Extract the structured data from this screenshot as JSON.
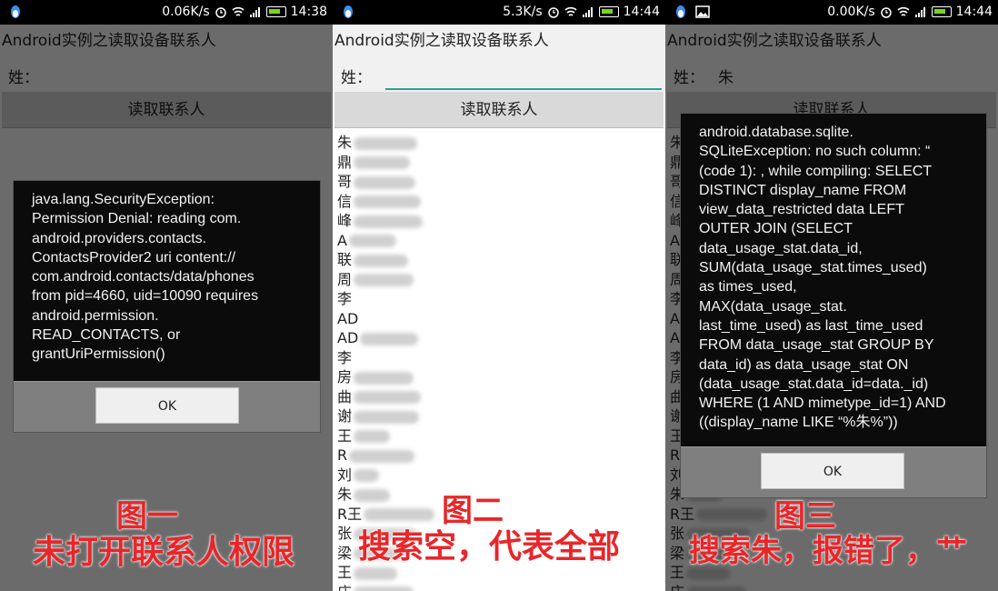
{
  "app_title": "Android实例之读取设备联系人",
  "surname_label": "姓：",
  "read_button_label": "读取联系人",
  "phones": [
    {
      "status": {
        "speed": "0.06K/s",
        "time": "14:38"
      },
      "surname_value": "",
      "dialog_message": "java.lang.SecurityException:\nPermission Denial: reading com.\nandroid.providers.contacts.\nContactsProvider2 uri content://\ncom.android.contacts/data/phones\nfrom pid=4660, uid=10090 requires\nandroid.permission.\nREAD_CONTACTS, or\ngrantUriPermission()",
      "dialog_button": "OK",
      "caption_title": "图一",
      "caption_text": "未打开联系人权限"
    },
    {
      "status": {
        "speed": "5.3K/s",
        "time": "14:44"
      },
      "surname_value": "",
      "caption_title": "图二",
      "caption_text": "搜索空，代表全部"
    },
    {
      "status": {
        "speed": "0.00K/s",
        "time": "14:44"
      },
      "surname_value": "朱",
      "dialog_message": "android.database.sqlite.\nSQLiteException: no such column: “\n(code 1): , while compiling: SELECT\nDISTINCT display_name FROM\nview_data_restricted data LEFT\nOUTER JOIN (SELECT\ndata_usage_stat.data_id,\nSUM(data_usage_stat.times_used)\nas times_used,\nMAX(data_usage_stat.\nlast_time_used) as last_time_used\nFROM data_usage_stat GROUP BY\ndata_id) as data_usage_stat ON\n(data_usage_stat.data_id=data._id)\nWHERE (1 AND mimetype_id=1) AND\n((display_name LIKE “%朱%”))",
      "dialog_button": "OK",
      "caption_title": "图三",
      "caption_text": "搜索朱，报错了，艹"
    }
  ],
  "contacts_p2": [
    "朱",
    "鼎",
    "哥",
    "信",
    "峰",
    "A",
    "联",
    "周",
    "李",
    "AD",
    "AD",
    "李",
    "房",
    "曲",
    "谢",
    "王",
    "R",
    "刘",
    "朱",
    "R王",
    "张",
    "梁",
    "王",
    "庄"
  ],
  "contacts_p3": [
    "朱",
    "鼎",
    "哥",
    "信",
    "峰",
    "A",
    "联",
    "周",
    "李",
    "A",
    "A",
    "李",
    "房",
    "曲",
    "谢",
    "王",
    "R",
    "刘",
    "朱",
    "R王",
    "张",
    "梁",
    "王",
    "庄"
  ],
  "colors": {
    "caption": "#e8262a",
    "statusbar": "#000000",
    "dialog_bg": "#0b0b0b",
    "input_underline": "#2aa198"
  }
}
